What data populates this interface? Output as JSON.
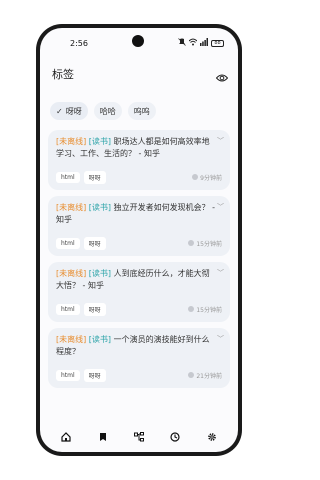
{
  "status_bar": {
    "time": "2:56",
    "indicators": [
      "mute-icon",
      "wifi-icon",
      "signal-icon"
    ],
    "battery": "88"
  },
  "header": {
    "title": "标签",
    "action_icon": "eye-icon"
  },
  "filters": [
    {
      "label": "呀呀",
      "selected": true
    },
    {
      "label": "哈哈",
      "selected": false
    },
    {
      "label": "呜呜",
      "selected": false
    }
  ],
  "cards": [
    {
      "tag1": "[未离线]",
      "tag2": "[读书]",
      "title": "职场达人都是如何高效率地学习、工作、生活的？ - 知乎",
      "tags": [
        "html",
        "呀呀"
      ],
      "time_ago": "9分钟前"
    },
    {
      "tag1": "[未离线]",
      "tag2": "[读书]",
      "title": "独立开发者如何发现机会？ - 知乎",
      "tags": [
        "html",
        "呀呀"
      ],
      "time_ago": "15分钟前"
    },
    {
      "tag1": "[未离线]",
      "tag2": "[读书]",
      "title": "人到底经历什么，才能大彻大悟？ - 知乎",
      "tags": [
        "html",
        "呀呀"
      ],
      "time_ago": "15分钟前"
    },
    {
      "tag1": "[未离线]",
      "tag2": "[读书]",
      "title": "一个演员的演技能好到什么程度？",
      "tags": [
        "html",
        "呀呀"
      ],
      "time_ago": "21分钟前"
    }
  ],
  "tabbar": [
    "home-icon",
    "bookmark-icon",
    "tree-icon",
    "clock-icon",
    "settings-icon"
  ],
  "colors": {
    "tag_offline": "#e88d2f",
    "tag_category": "#2aa3a8",
    "card_bg": "#eef1f6"
  }
}
